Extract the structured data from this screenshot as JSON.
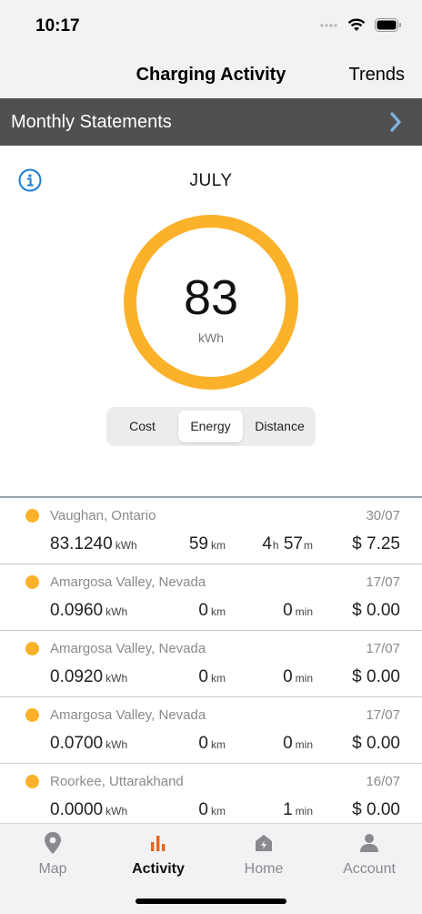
{
  "status_bar": {
    "time": "10:17"
  },
  "nav": {
    "title": "Charging Activity",
    "trends_label": "Trends"
  },
  "statements": {
    "label": "Monthly Statements"
  },
  "summary": {
    "month": "JULY",
    "value": "83",
    "unit": "kWh",
    "ring_color": "#fbb129",
    "segments": [
      "Cost",
      "Energy",
      "Distance"
    ],
    "selected_segment": "Energy"
  },
  "sessions": [
    {
      "location": "Vaughan, Ontario",
      "date": "30/07",
      "energy": "83.1240",
      "energy_unit": "kWh",
      "distance": "59",
      "distance_unit": "km",
      "duration_h": "4",
      "duration_h_unit": "h",
      "duration_m": "57",
      "duration_m_unit": "m",
      "cost": "$ 7.25"
    },
    {
      "location": "Amargosa Valley, Nevada",
      "date": "17/07",
      "energy": "0.0960",
      "energy_unit": "kWh",
      "distance": "0",
      "distance_unit": "km",
      "duration": "0",
      "duration_unit": "min",
      "cost": "$ 0.00"
    },
    {
      "location": "Amargosa Valley, Nevada",
      "date": "17/07",
      "energy": "0.0920",
      "energy_unit": "kWh",
      "distance": "0",
      "distance_unit": "km",
      "duration": "0",
      "duration_unit": "min",
      "cost": "$ 0.00"
    },
    {
      "location": "Amargosa Valley, Nevada",
      "date": "17/07",
      "energy": "0.0700",
      "energy_unit": "kWh",
      "distance": "0",
      "distance_unit": "km",
      "duration": "0",
      "duration_unit": "min",
      "cost": "$ 0.00"
    },
    {
      "location": "Roorkee, Uttarakhand",
      "date": "16/07",
      "energy": "0.0000",
      "energy_unit": "kWh",
      "distance": "0",
      "distance_unit": "km",
      "duration": "1",
      "duration_unit": "min",
      "cost": "$ 0.00"
    }
  ],
  "tabs": [
    {
      "label": "Map",
      "icon": "map-pin-icon"
    },
    {
      "label": "Activity",
      "icon": "bar-chart-icon"
    },
    {
      "label": "Home",
      "icon": "charger-home-icon"
    },
    {
      "label": "Account",
      "icon": "person-icon"
    }
  ],
  "active_tab": "Activity",
  "colors": {
    "accent": "#fbb129",
    "active_tab_icon": "#e8651f",
    "info_blue": "#1a7ed8",
    "header_gray": "#4f5052"
  }
}
